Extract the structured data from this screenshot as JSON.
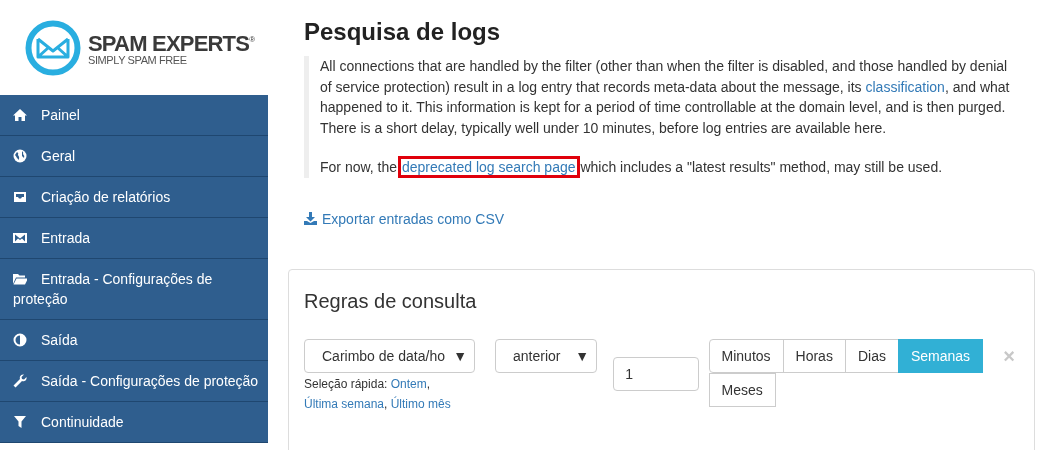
{
  "sidebar": {
    "logo": {
      "name": "SPAM EXPERTS",
      "mark": "®",
      "tagline": "SIMPLY SPAM FREE"
    },
    "items": [
      {
        "label": "Painel",
        "kind": "home"
      },
      {
        "label": "Geral",
        "kind": "globe"
      },
      {
        "label": "Criação de relatórios",
        "kind": "inbox"
      },
      {
        "label": "Entrada",
        "kind": "envelope"
      },
      {
        "label": "Entrada - Configurações de proteção",
        "kind": "folder"
      },
      {
        "label": "Saída",
        "kind": "contrast"
      },
      {
        "label": "Saída - Configurações de proteção",
        "kind": "wrench"
      },
      {
        "label": "Continuidade",
        "kind": "filter"
      }
    ]
  },
  "page": {
    "title": "Pesquisa de logs",
    "paragraphs": [
      [
        {
          "kind": "text",
          "text": "All connections that are handled by the filter (other than when the filter is disabled, and those handled by denial of service protection) result in a log entry that records meta-data about the message, its "
        },
        {
          "kind": "link",
          "text": "classification",
          "highlighted": false
        },
        {
          "kind": "text",
          "text": ", and what happened to it. This information is kept for a period of time controllable at the domain level, and is then purged. There is a short delay, typically well under 10 minutes, before log entries are available here."
        }
      ],
      [
        {
          "kind": "text",
          "text": "For now, the "
        },
        {
          "kind": "link",
          "text": "deprecated log search page",
          "highlighted": true
        },
        {
          "kind": "text",
          "text": " which includes a \"latest results\" method, may still be used."
        }
      ]
    ],
    "export_link": "Exportar entradas como CSV"
  },
  "query": {
    "title": "Regras de consulta",
    "rules": [
      {
        "field": "Carimbo de data/ho",
        "field_caret": "▼",
        "operator": "anterior",
        "operator_caret": "▼",
        "value": "1",
        "quick_select": [
          {
            "kind": "text",
            "text": "Seleção rápida: "
          },
          {
            "kind": "link",
            "text": "Ontem"
          },
          {
            "kind": "text",
            "text": ", "
          },
          {
            "kind": "link",
            "text": "Última semana"
          },
          {
            "kind": "text",
            "text": ", "
          },
          {
            "kind": "link",
            "text": "Último mês"
          }
        ],
        "units": [
          {
            "label": "Minutos",
            "selected": false
          },
          {
            "label": "Horas",
            "selected": false
          },
          {
            "label": "Dias",
            "selected": false
          },
          {
            "label": "Semanas",
            "selected": true
          },
          {
            "label": "Meses",
            "selected": false
          }
        ],
        "remove": "×"
      }
    ]
  }
}
